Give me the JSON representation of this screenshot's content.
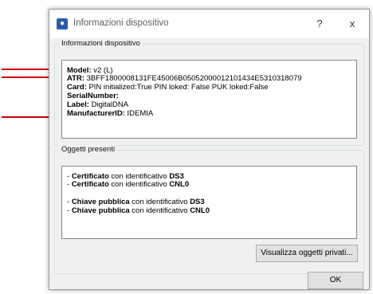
{
  "window": {
    "title": "Informazioni dispositivo",
    "help_label": "?",
    "close_label": "x"
  },
  "device_group": {
    "label": "Informazioni dispositivo",
    "lines": [
      {
        "key": "Model:",
        "value": " v2 (L)"
      },
      {
        "key": "ATR:",
        "value": " 3BFF1800008131FE45006B05052000012101434E5310318079"
      },
      {
        "key": "Card:",
        "value": " PIN initialized:True PIN loked: False PUK loked:False"
      },
      {
        "key": "SerialNumber:",
        "value": ""
      },
      {
        "key": "Label:",
        "value": " DigitalDNA"
      },
      {
        "key": "ManufacturerID:",
        "value": " IDEMIA"
      }
    ]
  },
  "objects_group": {
    "label": "Oggetti presenti",
    "items": [
      {
        "prefix": "- ",
        "name": "Certificato",
        "middle": " con identificativo ",
        "id": "DS3"
      },
      {
        "prefix": "- ",
        "name": "Certificato",
        "middle": " con identificativo ",
        "id": "CNL0"
      },
      {
        "prefix": "- ",
        "name": "Chiave pubblica",
        "middle": " con identificativo ",
        "id": "DS3"
      },
      {
        "prefix": "- ",
        "name": "Chiave pubblica",
        "middle": " con identificativo ",
        "id": "CNL0"
      }
    ],
    "private_button_label": "Visualizza oggetti privati..."
  },
  "ok_button_label": "OK",
  "colors": {
    "arrow": "#cc0000",
    "titlebar": "#ffffff",
    "dialog_bg": "#f0f0f0"
  }
}
